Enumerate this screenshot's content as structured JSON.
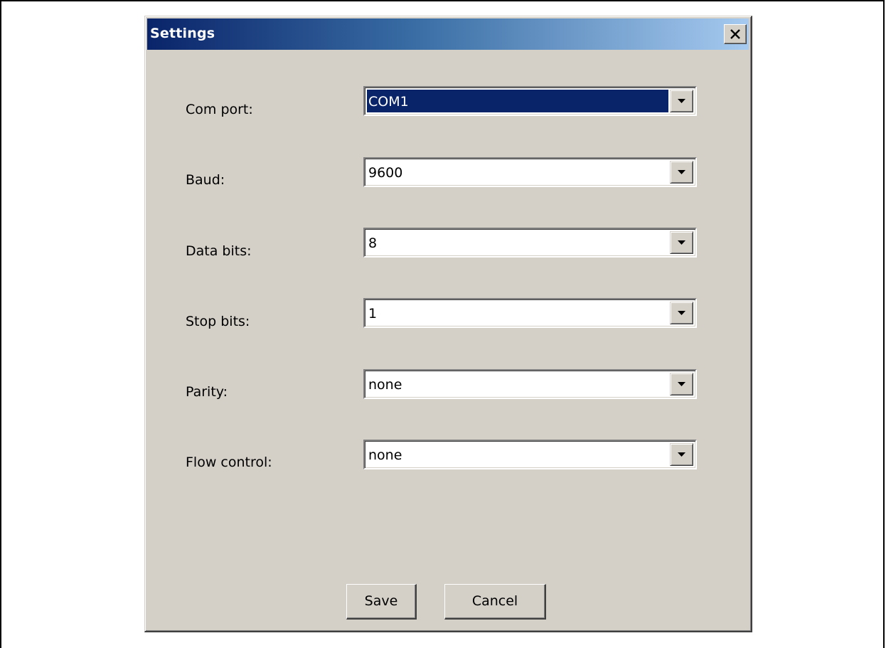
{
  "dialog": {
    "title": "Settings",
    "close_label": "X"
  },
  "fields": [
    {
      "label": "Com port:",
      "value": "COM1",
      "selected": true
    },
    {
      "label": "Baud:",
      "value": "9600",
      "selected": false
    },
    {
      "label": "Data bits:",
      "value": "8",
      "selected": false
    },
    {
      "label": "Stop bits:",
      "value": "1",
      "selected": false
    },
    {
      "label": "Parity:",
      "value": "none",
      "selected": false
    },
    {
      "label": "Flow control:",
      "value": "none",
      "selected": false
    }
  ],
  "buttons": {
    "save_label": "Save",
    "cancel_label": "Cancel"
  },
  "icons": {
    "close": "close-icon",
    "dropdown": "chevron-down-icon"
  },
  "colors": {
    "dialog_bg": "#d4d0c8",
    "title_gradient_start": "#0a246a",
    "title_gradient_end": "#a6caf0",
    "selection_bg": "#0a246a"
  }
}
